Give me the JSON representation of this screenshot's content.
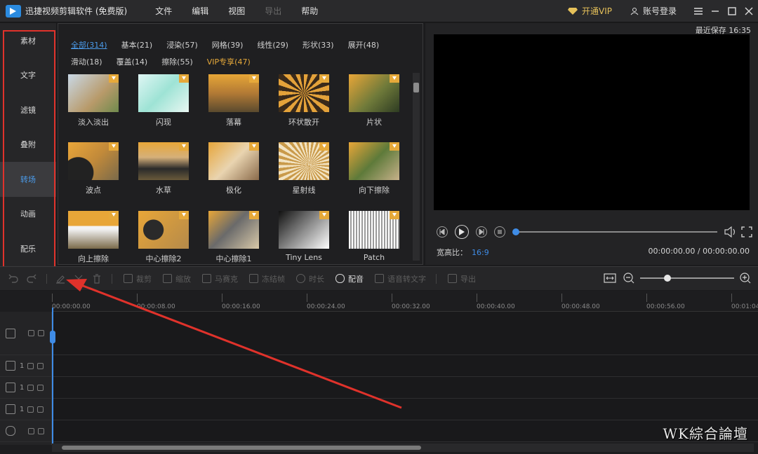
{
  "app": {
    "title": "迅捷视频剪辑软件 (免费版)",
    "menu": [
      "文件",
      "编辑",
      "视图",
      "导出",
      "帮助"
    ],
    "vip_label": "开通VIP",
    "login_label": "账号登录"
  },
  "categories": [
    "素材",
    "文字",
    "滤镜",
    "叠附",
    "转场",
    "动画",
    "配乐"
  ],
  "filters": {
    "row1": [
      "全部(314)",
      "基本(21)",
      "浸染(57)",
      "网格(39)",
      "线性(29)",
      "形状(33)",
      "展开(48)"
    ],
    "row2": [
      "滑动(18)",
      "覆盖(14)",
      "擦除(55)",
      "VIP专享(47)"
    ]
  },
  "transitions": [
    {
      "label": "淡入淡出"
    },
    {
      "label": "闪现"
    },
    {
      "label": "落幕"
    },
    {
      "label": "环状散开"
    },
    {
      "label": "片状"
    },
    {
      "label": "波点"
    },
    {
      "label": "水草"
    },
    {
      "label": "极化"
    },
    {
      "label": "星射线"
    },
    {
      "label": "向下擦除"
    },
    {
      "label": "向上擦除"
    },
    {
      "label": "中心擦除2"
    },
    {
      "label": "中心擦除1"
    },
    {
      "label": "Tiny Lens"
    },
    {
      "label": "Patch"
    }
  ],
  "preview": {
    "last_save": "最近保存 16:35",
    "ratio_label": "宽高比：",
    "ratio_value": "16:9",
    "timecode": "00:00:00.00 / 00:00:00.00"
  },
  "toolbar": {
    "items": [
      "裁剪",
      "缩放",
      "马赛克",
      "冻结帧",
      "时长",
      "配音",
      "语音转文字",
      "导出"
    ]
  },
  "timeline": {
    "ticks": [
      "00:00:00.00",
      "00:00:08.00",
      "00:00:16.00",
      "00:00:24.00",
      "00:00:32.00",
      "00:00:40.00",
      "00:00:48.00",
      "00:00:56.00",
      "00:01:04"
    ],
    "track_numbers": [
      "1",
      "1",
      "1"
    ]
  },
  "watermark": "WK綜合論壇",
  "colors": {
    "accent": "#3f8ce6",
    "vip": "#e6a93a",
    "annotation": "#e0322b"
  }
}
